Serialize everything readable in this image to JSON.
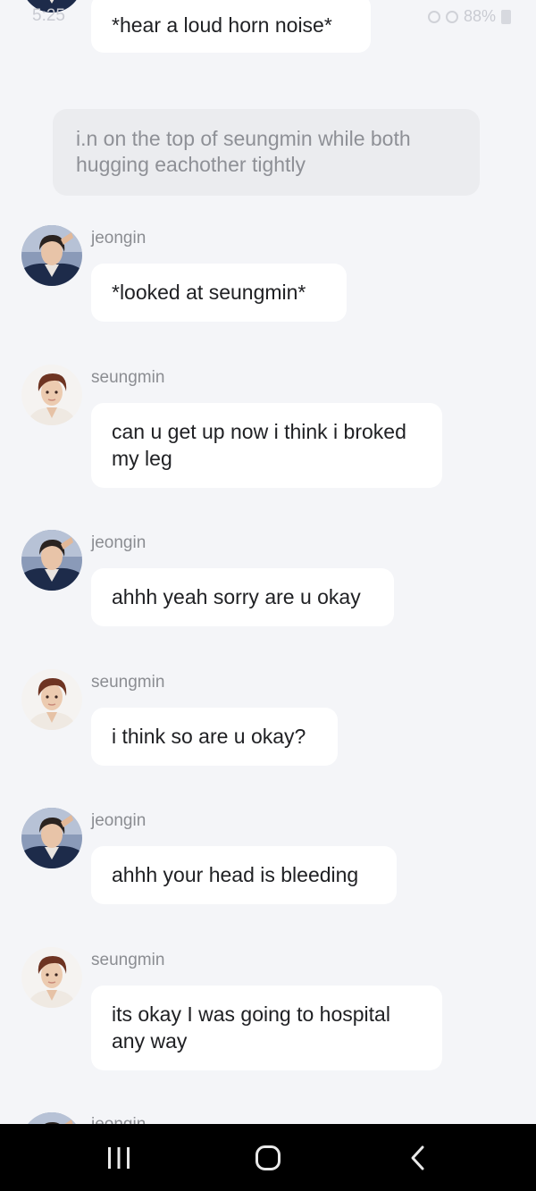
{
  "status_bar": {
    "time": "5:25",
    "battery_percent": "88%"
  },
  "top_message": {
    "text": "*hear a loud horn noise*"
  },
  "narration": {
    "text": "i.n on the top of seungmin while both hugging eachother tightly"
  },
  "messages": [
    {
      "sender": "jeongin",
      "text": "*looked at seungmin*",
      "avatar": "jeongin-avatar"
    },
    {
      "sender": "seungmin",
      "text": "can u get up now i think i broked my leg",
      "avatar": "seungmin-avatar"
    },
    {
      "sender": "jeongin",
      "text": "ahhh yeah sorry are u okay",
      "avatar": "jeongin-avatar"
    },
    {
      "sender": "seungmin",
      "text": "i think so are u okay?",
      "avatar": "seungmin-avatar"
    },
    {
      "sender": "jeongin",
      "text": "ahhh your head is bleeding",
      "avatar": "jeongin-avatar"
    },
    {
      "sender": "seungmin",
      "text": "its okay I was going to hospital any way",
      "avatar": "seungmin-avatar"
    },
    {
      "sender": "jeongin",
      "text": "",
      "avatar": "jeongin-avatar"
    }
  ],
  "nav_bar": {
    "recents": "recent-apps-icon",
    "home": "home-icon",
    "back": "back-icon"
  },
  "colors": {
    "background": "#f4f5f8",
    "bubble": "#ffffff",
    "narration_bubble": "#ebecef",
    "narration_text": "#8e9096",
    "sender_name": "#8b8d92",
    "nav_bar": "#000000"
  }
}
